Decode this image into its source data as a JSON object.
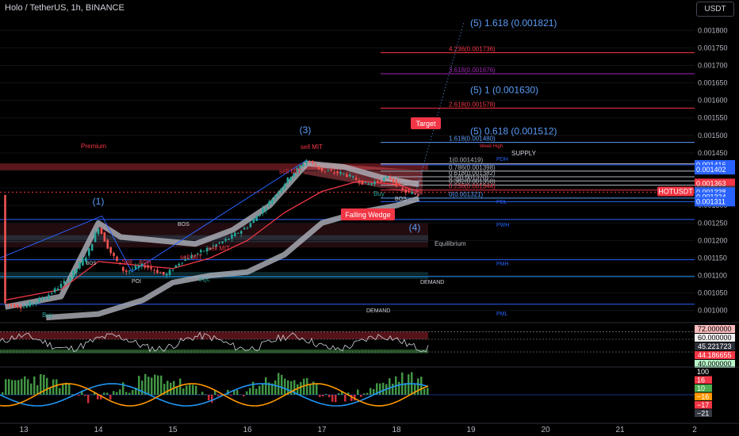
{
  "header": {
    "title": "Holo / TetherUS, 1h, BINANCE",
    "currency_button": "USDT"
  },
  "colors": {
    "background": "#000000",
    "up": "#26a69a",
    "down": "#ef5350",
    "fib_blue": "#5b9cf6",
    "red_line": "#f23645",
    "purple": "#9c27b0"
  },
  "chart_data": [
    {
      "type": "candlestick",
      "title": "Holo / TetherUS, 1h, BINANCE",
      "ylim": [
        0.00097,
        0.00183
      ],
      "y_ticks": [
        "0.001800",
        "0.001750",
        "0.001700",
        "0.001650",
        "0.001600",
        "0.001550",
        "0.001500",
        "0.001450",
        "0.001400",
        "0.001350",
        "0.001300",
        "0.001250",
        "0.001200",
        "0.001150",
        "0.001100",
        "0.001050",
        "0.001000"
      ],
      "x_ticks": [
        {
          "label": "13",
          "day": 13
        },
        {
          "label": "14",
          "day": 14
        },
        {
          "label": "15",
          "day": 15
        },
        {
          "label": "16",
          "day": 16
        },
        {
          "label": "17",
          "day": 17
        },
        {
          "label": "18",
          "day": 18
        },
        {
          "label": "19",
          "day": 19
        },
        {
          "label": "20",
          "day": 20
        },
        {
          "label": "21",
          "day": 21
        },
        {
          "label": "2",
          "day": 22
        }
      ],
      "price_path": [
        [
          12.75,
          0.00102
        ],
        [
          13.0,
          0.00101
        ],
        [
          13.3,
          0.00104
        ],
        [
          13.6,
          0.00109
        ],
        [
          13.85,
          0.00116
        ],
        [
          14.0,
          0.00124
        ],
        [
          14.15,
          0.00117
        ],
        [
          14.35,
          0.00111
        ],
        [
          14.6,
          0.00113
        ],
        [
          14.9,
          0.0011
        ],
        [
          15.1,
          0.00114
        ],
        [
          15.4,
          0.00117
        ],
        [
          15.7,
          0.0012
        ],
        [
          16.0,
          0.00124
        ],
        [
          16.3,
          0.00131
        ],
        [
          16.6,
          0.00139
        ],
        [
          16.8,
          0.00143
        ],
        [
          17.0,
          0.0014
        ],
        [
          17.3,
          0.00139
        ],
        [
          17.6,
          0.00136
        ],
        [
          17.9,
          0.00138
        ],
        [
          18.1,
          0.00134
        ],
        [
          18.3,
          0.00133
        ]
      ],
      "fib_levels": [
        {
          "label": "4.236(0.001736)",
          "value": 0.001736,
          "color": "#f23645"
        },
        {
          "label": "3.618(0.001676)",
          "value": 0.001676,
          "color": "#9c27b0"
        },
        {
          "label": "2.618(0.001578)",
          "value": 0.001578,
          "color": "#f23645"
        },
        {
          "label": "1.618(0.001480)",
          "value": 0.00148,
          "color": "#5b9cf6"
        },
        {
          "label": "1(0.001419)",
          "value": 0.001419,
          "color": "#b2b5be"
        },
        {
          "label": "0.786(0.001398)",
          "value": 0.001398,
          "color": "#b2b5be"
        },
        {
          "label": "0.618(0.001382)",
          "value": 0.001382,
          "color": "#b2b5be"
        },
        {
          "label": "0.5(0.001370)",
          "value": 0.00137,
          "color": "#b2b5be"
        },
        {
          "label": "0.382(0.001358)",
          "value": 0.001358,
          "color": "#b2b5be"
        },
        {
          "label": "0.236(0.001344)",
          "value": 0.001344,
          "color": "#f23645"
        },
        {
          "label": "0(0.001321)",
          "value": 0.001321,
          "color": "#5b9cf6"
        }
      ],
      "wave_targets": [
        {
          "label": "(5) 1.618 (0.001821)",
          "value": 0.001821
        },
        {
          "label": "(5) 1 (0.001630)",
          "value": 0.00163
        },
        {
          "label": "(5) 0.618 (0.001512)",
          "value": 0.001512
        }
      ],
      "zone_labels": {
        "premium": "Premium",
        "supply": "SUPPLY",
        "equilibrium": "Equilibrium",
        "demand1": "DEMAND",
        "demand2": "DEMAND",
        "pdh": "PDH",
        "pdl": "PDL",
        "pwh": "PWH",
        "pmh": "PMH",
        "pml": "PML",
        "bos1": "BOS",
        "bos2": "BOS",
        "week_high": "Week High"
      },
      "wave_labels": {
        "w1": "(1)",
        "w3": "(3)",
        "w4": "(4)"
      },
      "signals": {
        "sell1": "sell MIT",
        "sell2": "sell MIT",
        "sell3": "sell MIT",
        "sell4": "sell MIT",
        "sell5": "Sell",
        "buy1": "Buy",
        "buy2": "Buy",
        "poi": "POI",
        "eql": "EQL",
        "eqh": "EQH",
        "bos_small": "BOS"
      },
      "callouts": {
        "target": "Target",
        "falling_wedge": "Falling Wedge"
      },
      "price_badges": [
        {
          "text": "0.001416",
          "value": 0.001416,
          "color": "#2962ff"
        },
        {
          "text": "0.001402",
          "value": 0.001402,
          "color": "#2962ff"
        },
        {
          "text": "0.001363",
          "value": 0.001363,
          "color": "#f23645"
        },
        {
          "text": "0.001342",
          "value": 0.001342,
          "color": "#363a45"
        },
        {
          "text": "0.001338",
          "value": 0.001338,
          "color": "#f23645"
        },
        {
          "text": "46:12",
          "value": 0.00133,
          "color": "#f23645"
        },
        {
          "text": "0.001338",
          "value": 0.001338,
          "color": "#2962ff"
        },
        {
          "text": "0.001324",
          "value": 0.001324,
          "color": "#2962ff"
        },
        {
          "text": "0.001311",
          "value": 0.001311,
          "color": "#2962ff"
        }
      ],
      "symbol_badge": "HOTUSDT"
    },
    {
      "type": "line",
      "title": "RSI panel",
      "levels": {
        "upper": 72,
        "middle": 60,
        "lower": 40
      },
      "badges": [
        {
          "text": "72.000000",
          "color": "#f8bbbb"
        },
        {
          "text": "60.000000",
          "color": "#f0f0f0"
        },
        {
          "text": "45.221723",
          "color": "#2a2e39"
        },
        {
          "text": "44.186655",
          "color": "#f23645"
        },
        {
          "text": "40.000000",
          "color": "#b9f6ca"
        }
      ]
    },
    {
      "type": "bar",
      "title": "Momentum panel",
      "badges": [
        {
          "text": "100",
          "color": "#000000"
        },
        {
          "text": "16",
          "color": "#f23645"
        },
        {
          "text": "10",
          "color": "#4caf50"
        },
        {
          "text": "−16",
          "color": "#ff9800"
        },
        {
          "text": "−17",
          "color": "#f23645"
        },
        {
          "text": "−21",
          "color": "#363a45"
        }
      ]
    }
  ]
}
